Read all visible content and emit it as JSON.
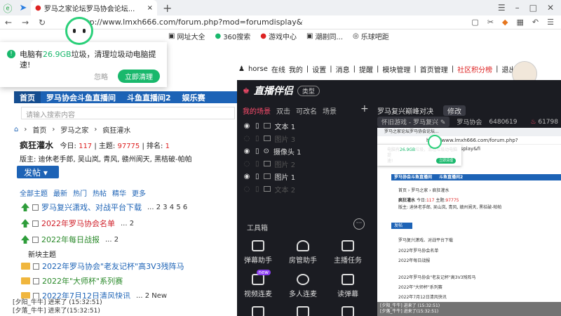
{
  "browser": {
    "tab_title": "罗马之家论坛罗马协会论坛...",
    "url": "http://www.lmxh666.com/forum.php?mod=forumdisplay&fi",
    "bookmarks": [
      "网址大全",
      "360搜索",
      "游戏中心",
      "潮剧同...",
      "乐球吧距"
    ]
  },
  "cleanup_tip": {
    "line1_prefix": "电脑有",
    "size": "26.9GB",
    "line1_suffix": "垃圾，清理垃圾动电脑提",
    "line2": "速!",
    "ignore": "忽略",
    "clean": "立即清理"
  },
  "userbar": {
    "user": "horse",
    "online": "在线",
    "items": [
      "我的",
      "设置",
      "消息",
      "提醒",
      "模块管理",
      "首页管理"
    ],
    "points": "社区积分榜",
    "logout": "退出"
  },
  "forum_nav": [
    "首页",
    "罗马协会斗鱼直播间",
    "斗鱼直播间2",
    "娱乐赛"
  ],
  "search": {
    "placeholder": "请输入搜索内容"
  },
  "breadcrumb": [
    "首页",
    "罗马之家",
    "疯狂灌水"
  ],
  "board": {
    "name": "疯狂灌水",
    "today_label": "今日:",
    "today": "117",
    "topics_label": "主题:",
    "topics": "97775",
    "rank_label": "排名:",
    "rank": "1",
    "mods": "版主: 迪休老手郎, 吴山岚, 青风, 赣州阆天, 黑桔破-帕帕"
  },
  "post_button": "发帖",
  "filters": [
    "全部主题",
    "最新",
    "热门",
    "热帖",
    "精华",
    "更多"
  ],
  "threads": [
    {
      "title": "罗马复兴潇戏、对战平台下载",
      "pages": "... 2 3 4 5 6",
      "style": "blue",
      "icon": "arrow"
    },
    {
      "title": "2022年罗马协会名单",
      "pages": "... 2",
      "style": "red",
      "icon": "arrow"
    },
    {
      "title": "2022年每日战报",
      "pages": "... 2",
      "style": "green",
      "icon": "arrow"
    },
    {
      "title": "2022年罗马协会\"老友记杯\"高3V3残阵马",
      "pages": "",
      "style": "blue",
      "icon": "folder"
    },
    {
      "title": "2022年\"大师杯\"系列赛",
      "pages": "",
      "style": "green",
      "icon": "folder"
    },
    {
      "title": "2022年7月12日清风快讯",
      "pages": "... 2 New",
      "style": "blue",
      "icon": "folder"
    }
  ],
  "new_topic_label": "新块主题",
  "chat": {
    "line1": "[夕阳_牛牛] 进来了 (15:32:51)",
    "line2": "[夕落_牛牛] 进来了(15:32:51)"
  },
  "live": {
    "logo": "直播伴侣",
    "tag": "类型",
    "scene_tabs": [
      "我的场景",
      "双击",
      "可改名",
      "场景"
    ],
    "sources": [
      {
        "label": "文本 1",
        "dim": false
      },
      {
        "label": "图片 3",
        "dim": true
      },
      {
        "label": "摄像头 1",
        "dim": false
      },
      {
        "label": "图片 2",
        "dim": true
      },
      {
        "label": "图片 1",
        "dim": false
      },
      {
        "label": "文本 2",
        "dim": true
      }
    ],
    "tools_label": "工具箱",
    "tools": [
      "弹幕助手",
      "房管助手",
      "主播任务",
      "视频连麦",
      "多人连麦",
      "读弹幕"
    ],
    "tool_new_badge": "new",
    "room_title": "罗马复兴巅峰对决",
    "modify": "修改",
    "category": "怀旧游戏 - 罗马复兴",
    "room_owner": "罗马协会",
    "room_id": "6480619",
    "viewers": "61798"
  }
}
